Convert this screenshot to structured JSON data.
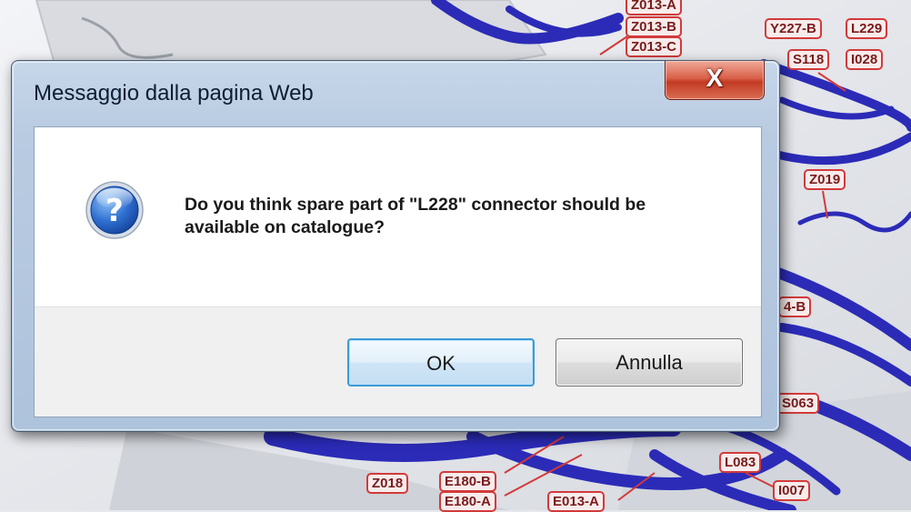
{
  "background": {
    "labels": [
      "Z013-A",
      "Z013-B",
      "Z013-C",
      "Y227-B",
      "L229",
      "S118",
      "I028",
      "Z019",
      "4-B",
      "S063",
      "L083",
      "I007",
      "Z018",
      "E180-B",
      "E180-A",
      "E013-A"
    ]
  },
  "dialog": {
    "title": "Messaggio dalla pagina Web",
    "close_glyph": "X",
    "icon": "question-icon",
    "icon_glyph": "?",
    "message_line1": "Do you think spare part of \"L228\" connector should be",
    "message_line2": "available on catalogue?",
    "ok_label": "OK",
    "cancel_label": "Annulla"
  },
  "colors": {
    "wire": "#2b2bb8",
    "label_border": "#d23a3a",
    "title_bar": "#b9cbe1",
    "close_button": "#c9452d",
    "ok_focus": "#3c9ad6"
  }
}
